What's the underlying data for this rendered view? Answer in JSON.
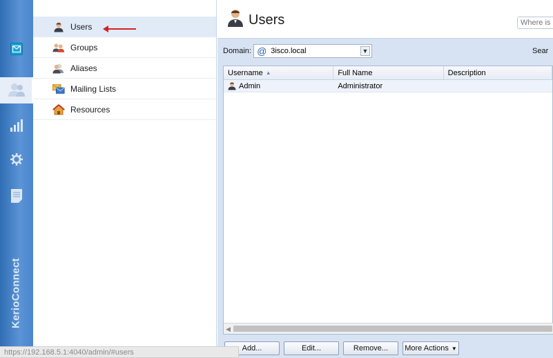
{
  "rail": {
    "brand": "KerioConnect",
    "items": [
      {
        "icon": "mail-icon"
      },
      {
        "icon": "users-icon"
      },
      {
        "icon": "stats-icon"
      },
      {
        "icon": "gear-icon"
      },
      {
        "icon": "document-icon"
      }
    ]
  },
  "nav": {
    "items": [
      {
        "label": "Users",
        "icon": "user-icon"
      },
      {
        "label": "Groups",
        "icon": "group-icon"
      },
      {
        "label": "Aliases",
        "icon": "alias-icon"
      },
      {
        "label": "Mailing Lists",
        "icon": "mailing-list-icon"
      },
      {
        "label": "Resources",
        "icon": "resource-icon"
      }
    ]
  },
  "header": {
    "title": "Users",
    "search_placeholder": "Where is ..."
  },
  "toolbar": {
    "domain_label": "Domain:",
    "domain_value": "3isco.local",
    "search_label": "Sear"
  },
  "grid": {
    "columns": [
      "Username",
      "Full Name",
      "Description"
    ],
    "rows": [
      {
        "username": "Admin",
        "full_name": "Administrator",
        "description": ""
      }
    ]
  },
  "footer": {
    "add": "Add...",
    "edit": "Edit...",
    "remove": "Remove...",
    "more": "More Actions"
  },
  "status": {
    "url": "https://192.168.5.1:4040/admin/#users"
  },
  "colors": {
    "rail": "#3f7ec6",
    "annotation": "#d42020",
    "selection": "#e1eaf7"
  }
}
